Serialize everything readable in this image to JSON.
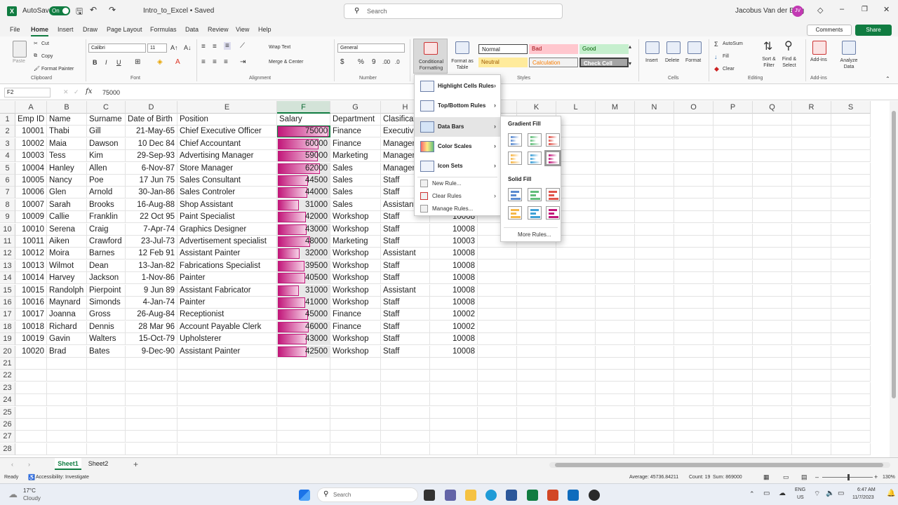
{
  "titlebar": {
    "autosave": "AutoSave",
    "toggle": "On",
    "filename": "Intro_to_Excel • Saved",
    "search_placeholder": "Search",
    "user": "Jacobus Van der Berg",
    "initials": "JV"
  },
  "menu": [
    "File",
    "Home",
    "Insert",
    "Draw",
    "Page Layout",
    "Formulas",
    "Data",
    "Review",
    "View",
    "Help"
  ],
  "menu_active": "Home",
  "comments": "Comments",
  "share": "Share",
  "ribbon": {
    "clipboard": {
      "paste": "Paste",
      "cut": "Cut",
      "copy": "Copy",
      "format_painter": "Format Painter",
      "label": "Clipboard"
    },
    "font": {
      "name": "Calibri",
      "size": "11",
      "label": "Font"
    },
    "alignment": {
      "wrap": "Wrap Text",
      "merge": "Merge & Center",
      "label": "Alignment"
    },
    "number": {
      "format": "General",
      "label": "Number"
    },
    "styles": {
      "cf": "Conditional Formatting",
      "fat": "Format as Table",
      "normal": "Normal",
      "bad": "Bad",
      "good": "Good",
      "neutral": "Neutral",
      "calculation": "Calculation",
      "check": "Check Cell",
      "label": "Styles"
    },
    "cells": {
      "insert": "Insert",
      "delete": "Delete",
      "format": "Format",
      "label": "Cells"
    },
    "editing": {
      "autosum": "AutoSum",
      "fill": "Fill",
      "clear": "Clear",
      "sort": "Sort & Filter",
      "find": "Find & Select",
      "label": "Editing"
    },
    "addins": {
      "addins": "Add-ins",
      "analyze": "Analyze Data",
      "label": "Add-ins"
    }
  },
  "formula_bar": {
    "name_box": "F2",
    "fx": "fx",
    "value": "75000"
  },
  "columns": [
    "A",
    "B",
    "C",
    "D",
    "E",
    "F",
    "G",
    "H",
    "I",
    "J",
    "K",
    "L",
    "M",
    "N",
    "O",
    "P",
    "Q",
    "R",
    "S"
  ],
  "rows_count": 28,
  "header_row": [
    "Emp ID",
    "Name",
    "Surname",
    "Date of Birth",
    "Position",
    "Salary",
    "Department",
    "Clasification"
  ],
  "rows": [
    [
      "10001",
      "Thabi",
      "Gill",
      "21-May-65",
      "Chief Executive Officer",
      "75000",
      "Finance",
      "Executive",
      "10002"
    ],
    [
      "10002",
      "Maia",
      "Dawson",
      "10 Dec 84",
      "Chief Accountant",
      "60000",
      "Finance",
      "Management",
      "10002"
    ],
    [
      "10003",
      "Tess",
      "Kim",
      "29-Sep-93",
      "Advertising Manager",
      "59000",
      "Marketing",
      "Management",
      "10003"
    ],
    [
      "10004",
      "Hanley",
      "Allen",
      "6-Nov-87",
      "Store Manager",
      "62000",
      "Sales",
      "Management",
      "10007"
    ],
    [
      "10005",
      "Nancy",
      "Poe",
      "17 Jun 75",
      "Sales Consultant",
      "44500",
      "Sales",
      "Staff",
      "10007"
    ],
    [
      "10006",
      "Glen",
      "Arnold",
      "30-Jan-86",
      "Sales Controler",
      "44000",
      "Sales",
      "Staff",
      "10007"
    ],
    [
      "10007",
      "Sarah",
      "Brooks",
      "16-Aug-88",
      "Shop Assistant",
      "31000",
      "Sales",
      "Assistant",
      "10007"
    ],
    [
      "10009",
      "Callie",
      "Franklin",
      "22 Oct 95",
      "Paint Specialist",
      "42000",
      "Workshop",
      "Staff",
      "10008"
    ],
    [
      "10010",
      "Serena",
      "Craig",
      "7-Apr-74",
      "Graphics Designer",
      "43000",
      "Workshop",
      "Staff",
      "10008"
    ],
    [
      "10011",
      "Aiken",
      "Crawford",
      "23-Jul-73",
      "Advertisement specialist",
      "48000",
      "Marketing",
      "Staff",
      "10003"
    ],
    [
      "10012",
      "Moira",
      "Barnes",
      "12 Feb 91",
      "Assistant Painter",
      "32000",
      "Workshop",
      "Assistant",
      "10008"
    ],
    [
      "10013",
      "Wilmot",
      "Dean",
      "13-Jan-82",
      "Fabrications Specialist",
      "39500",
      "Workshop",
      "Staff",
      "10008"
    ],
    [
      "10014",
      "Harvey",
      "Jackson",
      "1-Nov-86",
      "Painter",
      "40500",
      "Workshop",
      "Staff",
      "10008"
    ],
    [
      "10015",
      "Randolph",
      "Pierpoint",
      "9 Jun 89",
      "Assistant Fabricator",
      "31000",
      "Workshop",
      "Assistant",
      "10008"
    ],
    [
      "10016",
      "Maynard",
      "Simonds",
      "4-Jan-74",
      "Painter",
      "41000",
      "Workshop",
      "Staff",
      "10008"
    ],
    [
      "10017",
      "Joanna",
      "Gross",
      "26-Aug-84",
      "Receptionist",
      "45000",
      "Finance",
      "Staff",
      "10002"
    ],
    [
      "10018",
      "Richard",
      "Dennis",
      "28 Mar 96",
      "Account Payable Clerk",
      "46000",
      "Finance",
      "Staff",
      "10002"
    ],
    [
      "10019",
      "Gavin",
      "Walters",
      "15-Oct-79",
      "Upholsterer",
      "43000",
      "Workshop",
      "Staff",
      "10008"
    ],
    [
      "10020",
      "Brad",
      "Bates",
      "9-Dec-90",
      "Assistant Painter",
      "42500",
      "Workshop",
      "Staff",
      "10008"
    ]
  ],
  "salary_max": 75000,
  "cf_menu": {
    "items": [
      "Highlight Cells Rules",
      "Top/Bottom Rules",
      "Data Bars",
      "Color Scales",
      "Icon Sets"
    ],
    "small": [
      "New Rule...",
      "Clear Rules",
      "Manage Rules..."
    ]
  },
  "submenu": {
    "gradient": "Gradient Fill",
    "solid": "Solid Fill",
    "more": "More Rules...",
    "colors": [
      "#5b8bd0",
      "#63be7b",
      "#e0544b",
      "#f7b74a",
      "#3fa0d8",
      "#c2187a"
    ]
  },
  "sheets": [
    "Sheet1",
    "Sheet2"
  ],
  "status": {
    "ready": "Ready",
    "accessibility": "Accessibility: Investigate",
    "average": "Average: 45736.84211",
    "count": "Count: 19",
    "sum": "Sum: 869000",
    "zoom": "130%"
  },
  "taskbar": {
    "temp": "17°C",
    "weather": "Cloudy",
    "search": "Search",
    "lang1": "ENG",
    "lang2": "US",
    "time": "6:47 AM",
    "date": "11/7/2023"
  }
}
